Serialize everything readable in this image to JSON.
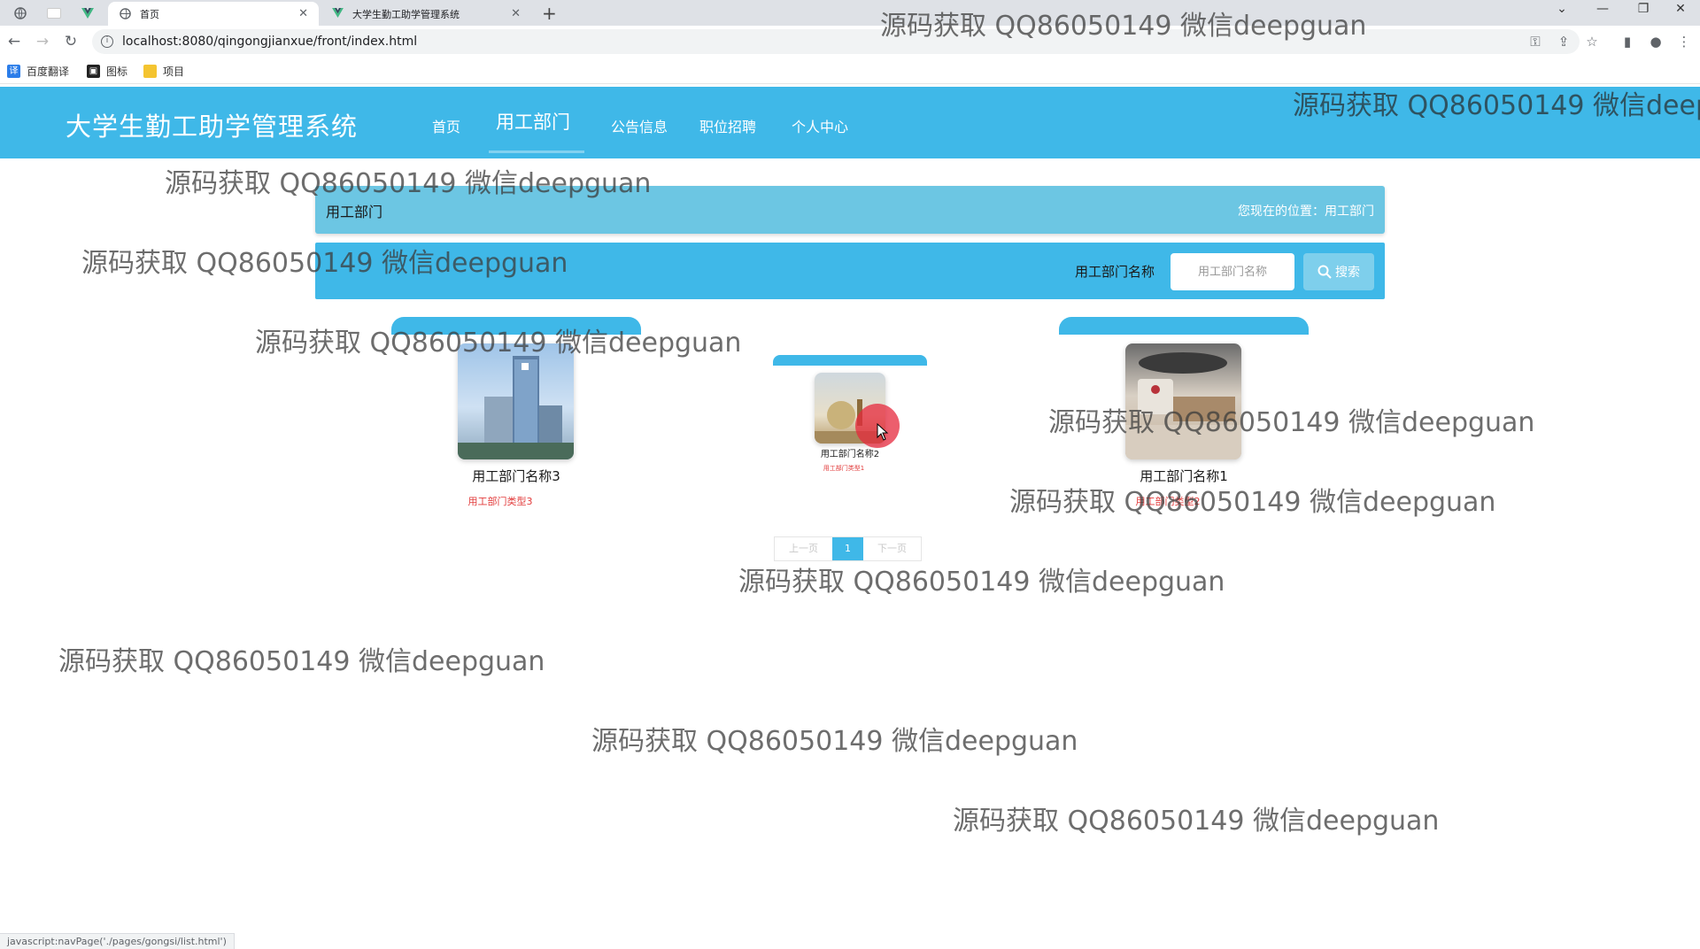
{
  "browser": {
    "tabs": [
      {
        "title": "首页",
        "active": true
      },
      {
        "title": "大学生勤工助学管理系统",
        "active": false
      }
    ],
    "url": "localhost:8080/qingongjianxue/front/index.html",
    "bookmarks": [
      "百度翻译",
      "图标",
      "项目"
    ],
    "status_text": "javascript:navPage('./pages/gongsi/list.html')"
  },
  "site": {
    "title": "大学生勤工助学管理系统",
    "nav": [
      "首页",
      "用工部门",
      "公告信息",
      "职位招聘",
      "个人中心"
    ],
    "active_nav": "用工部门"
  },
  "breadcrumb": {
    "title": "用工部门",
    "location": "您现在的位置：用工部门"
  },
  "search": {
    "label": "用工部门名称",
    "placeholder": "用工部门名称",
    "button": "搜索"
  },
  "cards": [
    {
      "name": "用工部门名称3",
      "type": "用工部门类型3",
      "image": "office-tower-photo"
    },
    {
      "name": "用工部门名称2",
      "type": "用工部门类型1",
      "image": "hotel-lobby-photo"
    },
    {
      "name": "用工部门名称1",
      "type": "用工部门类型2",
      "image": "reception-desk-photo"
    }
  ],
  "pagination": {
    "prev": "上一页",
    "current": "1",
    "next": "下一页"
  },
  "watermark": "源码获取 QQ86050149 微信deepguan",
  "colors": {
    "primary": "#3fb8e8",
    "breadcrumb": "#6cc6e3",
    "type_text": "#e23b3b"
  }
}
